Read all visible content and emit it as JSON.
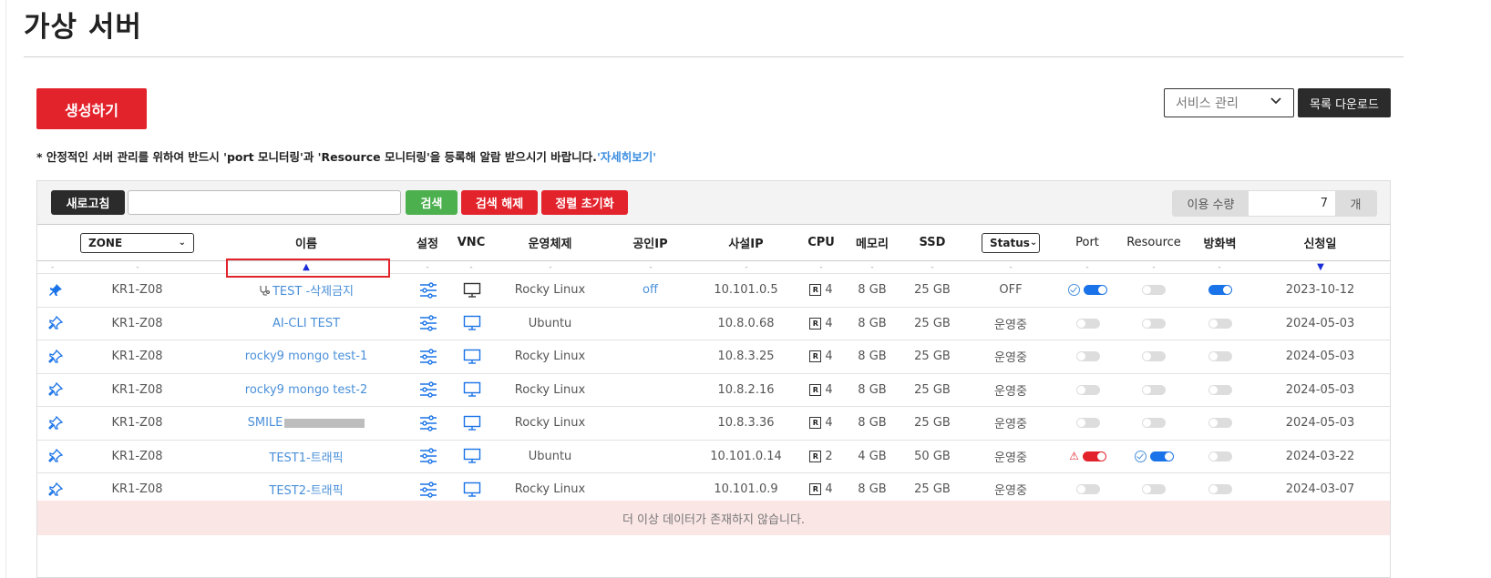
{
  "page": {
    "title": "가상 서버"
  },
  "actions": {
    "create_label": "생성하기",
    "service_select": "서비스 관리",
    "download_label": "목록 다운로드"
  },
  "notice": {
    "text": "* 안정적인 서버 관리를 위하여 반드시 'port 모니터링'과 'Resource 모니터링'을 등록해 알람 받으시기 바랍니다.",
    "link": "'자세히보기'"
  },
  "toolbar": {
    "refresh": "새로고침",
    "search_value": "",
    "search": "검색",
    "clear": "검색 해제",
    "reset": "정렬 초기화",
    "usage_label": "이용 수량",
    "usage_value": "7",
    "usage_unit": "개"
  },
  "columns": {
    "zone": "ZONE",
    "name": "이름",
    "settings": "설정",
    "vnc": "VNC",
    "os": "운영체제",
    "public_ip": "공인IP",
    "private_ip": "사설IP",
    "cpu": "CPU",
    "memory": "메모리",
    "ssd": "SSD",
    "status": "Status",
    "port": "Port",
    "resource": "Resource",
    "firewall": "방화벽",
    "date": "신청일"
  },
  "sort_markers": {
    "dot": "-",
    "up": "▲",
    "down": "▼"
  },
  "rows": [
    {
      "zone": "KR1-Z08",
      "name": "TEST -삭제금지",
      "os": "Rocky Linux",
      "public_ip": "off",
      "private_ip": "10.101.0.5",
      "cpu": "4",
      "memory": "8 GB",
      "ssd": "25 GB",
      "status": "OFF",
      "date": "2023-10-12"
    },
    {
      "zone": "KR1-Z08",
      "name": "AI-CLI TEST",
      "os": "Ubuntu",
      "public_ip": "",
      "private_ip": "10.8.0.68",
      "cpu": "4",
      "memory": "8 GB",
      "ssd": "25 GB",
      "status": "운영중",
      "date": "2024-05-03"
    },
    {
      "zone": "KR1-Z08",
      "name": "rocky9 mongo test-1",
      "os": "Rocky Linux",
      "public_ip": "",
      "private_ip": "10.8.3.25",
      "cpu": "4",
      "memory": "8 GB",
      "ssd": "25 GB",
      "status": "운영중",
      "date": "2024-05-03"
    },
    {
      "zone": "KR1-Z08",
      "name": "rocky9 mongo test-2",
      "os": "Rocky Linux",
      "public_ip": "",
      "private_ip": "10.8.2.16",
      "cpu": "4",
      "memory": "8 GB",
      "ssd": "25 GB",
      "status": "운영중",
      "date": "2024-05-03"
    },
    {
      "zone": "KR1-Z08",
      "name": "SMILE",
      "os": "Rocky Linux",
      "public_ip": "",
      "private_ip": "10.8.3.36",
      "cpu": "4",
      "memory": "8 GB",
      "ssd": "25 GB",
      "status": "운영중",
      "date": "2024-05-03"
    },
    {
      "zone": "KR1-Z08",
      "name": "TEST1-트래픽",
      "os": "Ubuntu",
      "public_ip": "",
      "private_ip": "10.101.0.14",
      "cpu": "2",
      "memory": "4 GB",
      "ssd": "50 GB",
      "status": "운영중",
      "date": "2024-03-22"
    },
    {
      "zone": "KR1-Z08",
      "name": "TEST2-트래픽",
      "os": "Rocky Linux",
      "public_ip": "",
      "private_ip": "10.101.0.9",
      "cpu": "4",
      "memory": "8 GB",
      "ssd": "25 GB",
      "status": "운영중",
      "date": "2024-03-07"
    }
  ],
  "footer": {
    "no_more": "더 이상 데이터가 존재하지 않습니다."
  },
  "colors": {
    "accent": "#e3232c",
    "link": "#4a90d9",
    "toggle_on": "#1a73e8",
    "search": "#4cb04f",
    "dark": "#2b2b2b"
  }
}
